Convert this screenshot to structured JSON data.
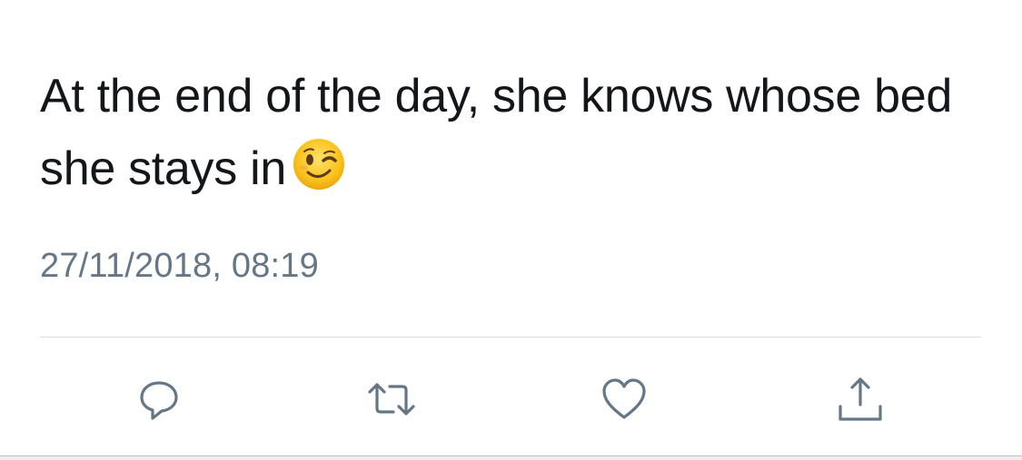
{
  "tweet": {
    "text": "At the end of the day, she knows whose bed she stays in",
    "emoji": "winking-face",
    "timestamp": "27/11/2018, 08:19"
  },
  "actions": {
    "reply": "reply-icon",
    "retweet": "retweet-icon",
    "like": "heart-icon",
    "share": "share-icon"
  },
  "colors": {
    "text": "#14171a",
    "secondary": "#657786",
    "divider": "#d8dde2",
    "emoji_face": "#fcc21b"
  }
}
